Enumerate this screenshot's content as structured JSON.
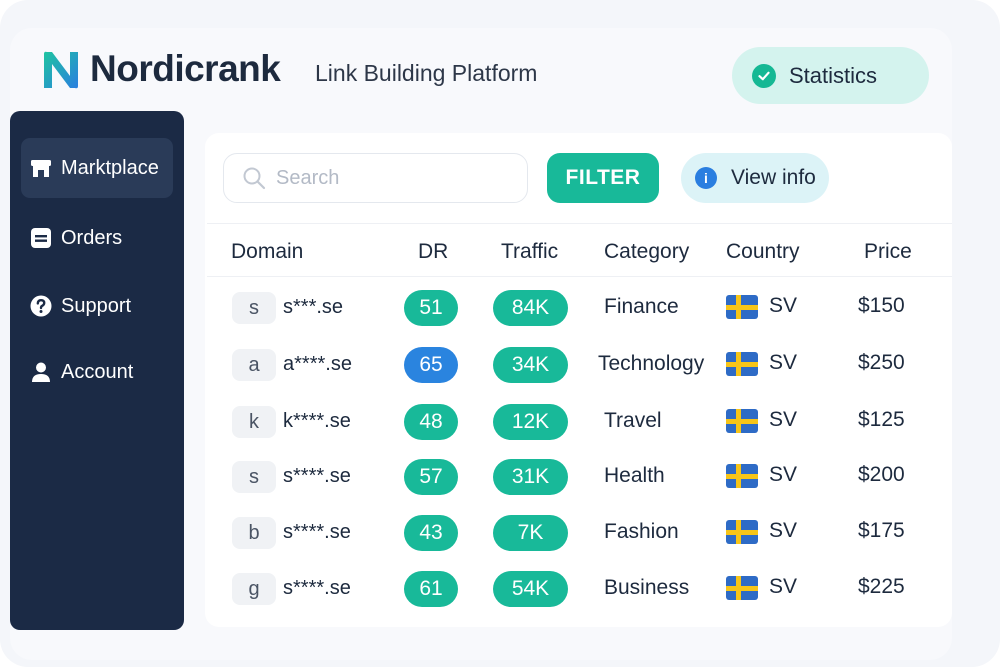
{
  "header": {
    "brand": "Nordicrank",
    "tagline": "Link Building Platform",
    "statistics_label": "Statistics"
  },
  "sidebar": {
    "items": [
      {
        "label": "Marktplace",
        "icon": "store-icon",
        "active": true
      },
      {
        "label": "Orders",
        "icon": "orders-icon",
        "active": false
      },
      {
        "label": "Support",
        "icon": "question-icon",
        "active": false
      },
      {
        "label": "Account",
        "icon": "user-icon",
        "active": false
      }
    ]
  },
  "toolbar": {
    "search_placeholder": "Search",
    "filter_label": "FILTER",
    "view_info_label": "View info"
  },
  "table": {
    "columns": [
      "Domain",
      "DR",
      "Traffic",
      "Category",
      "Country",
      "Price"
    ],
    "rows": [
      {
        "letter": "s",
        "domain": "s***.se",
        "dr": "51",
        "dr_color": "#18b999",
        "traffic": "84K",
        "category": "Finance",
        "country": "SV",
        "price": "$150"
      },
      {
        "letter": "a",
        "domain": "a****.se",
        "dr": "65",
        "dr_color": "#2a84df",
        "traffic": "34K",
        "category": "Technology",
        "country": "SV",
        "price": "$250"
      },
      {
        "letter": "k",
        "domain": "k****.se",
        "dr": "48",
        "dr_color": "#18b999",
        "traffic": "12K",
        "category": "Travel",
        "country": "SV",
        "price": "$125"
      },
      {
        "letter": "s",
        "domain": "s****.se",
        "dr": "57",
        "dr_color": "#18b999",
        "traffic": "31K",
        "category": "Health",
        "country": "SV",
        "price": "$200"
      },
      {
        "letter": "b",
        "domain": "s****.se",
        "dr": "43",
        "dr_color": "#18b999",
        "traffic": "7K",
        "category": "Fashion",
        "country": "SV",
        "price": "$175"
      },
      {
        "letter": "g",
        "domain": "s****.se",
        "dr": "61",
        "dr_color": "#18b999",
        "traffic": "54K",
        "category": "Business",
        "country": "SV",
        "price": "$225"
      }
    ]
  },
  "colors": {
    "accent": "#18b999",
    "sidebar": "#1b2a45",
    "dr_blue": "#2a84df",
    "flag_blue": "#2e6bc6",
    "flag_yellow": "#f7c518"
  }
}
